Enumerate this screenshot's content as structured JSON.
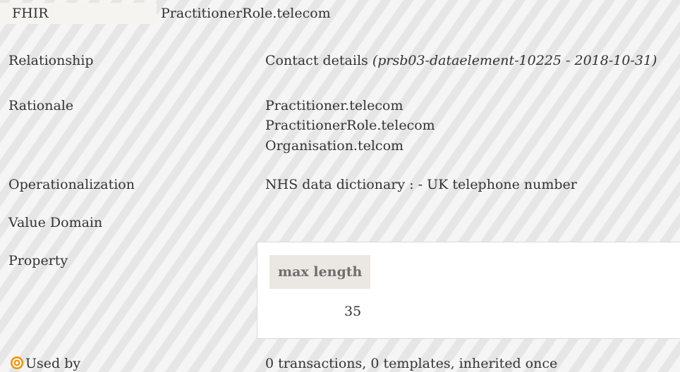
{
  "fhir": {
    "label": "FHIR",
    "value": "PractitionerRole.telecom"
  },
  "relationship": {
    "label": "Relationship",
    "value": "Contact details",
    "ref": "(prsb03-dataelement-10225 - 2018-10-31)"
  },
  "rationale": {
    "label": "Rationale",
    "lines": [
      "Practitioner.telecom",
      "PractitionerRole.telecom",
      "Organisation.telcom"
    ]
  },
  "operationalization": {
    "label": "Operationalization",
    "value": "NHS data dictionary : - UK telephone number"
  },
  "value_domain": {
    "label": "Value Domain"
  },
  "property": {
    "label": "Property",
    "header": "max length",
    "value": "35"
  },
  "used_by": {
    "icon": "target-icon",
    "label": "Used by",
    "value": "0 transactions, 0 templates, inherited once"
  },
  "colors": {
    "accent_orange": "#f39200",
    "stripe_light": "#f5f5f5",
    "stripe_dark": "#e6e6e6"
  }
}
